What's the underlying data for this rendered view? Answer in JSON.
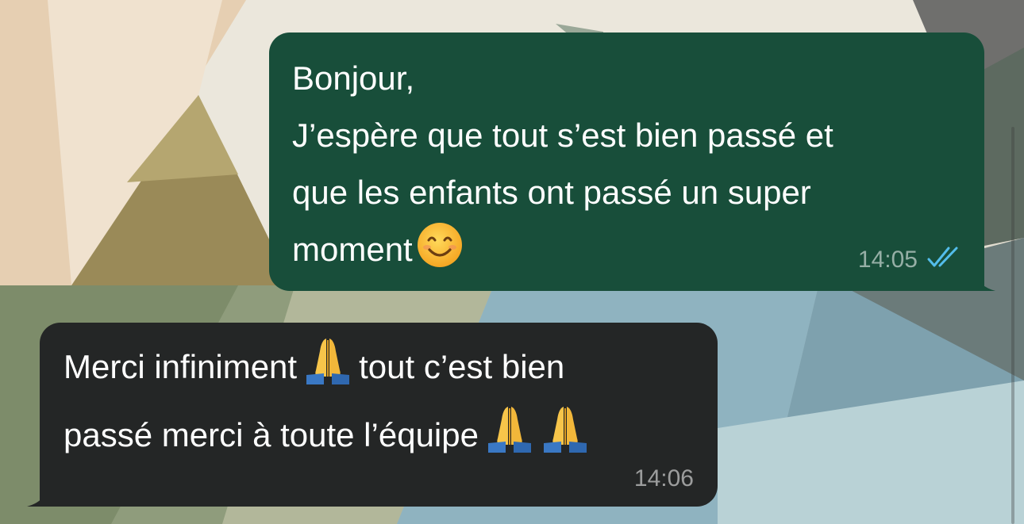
{
  "conversation": {
    "messages": [
      {
        "direction": "outgoing",
        "lines": [
          "Bonjour,",
          "J’espère que tout s’est bien passé et",
          "que les enfants ont passé un super",
          "moment"
        ],
        "emoji": "smiling-face-icon",
        "time": "14:05",
        "status_icon": "double-check-read-icon",
        "status_color": "#53bdeb"
      },
      {
        "direction": "incoming",
        "line1_before_emoji": "Merci infiniment",
        "line1_after_emoji": "tout c’est bien",
        "line2": "passé merci à toute l’équipe",
        "emoji": "folded-hands-icon",
        "time": "14:06"
      }
    ]
  },
  "theme": {
    "outgoing_bubble": "#184e3a",
    "incoming_bubble": "#242626",
    "text": "#ffffff",
    "read_ticks": "#53bdeb"
  }
}
